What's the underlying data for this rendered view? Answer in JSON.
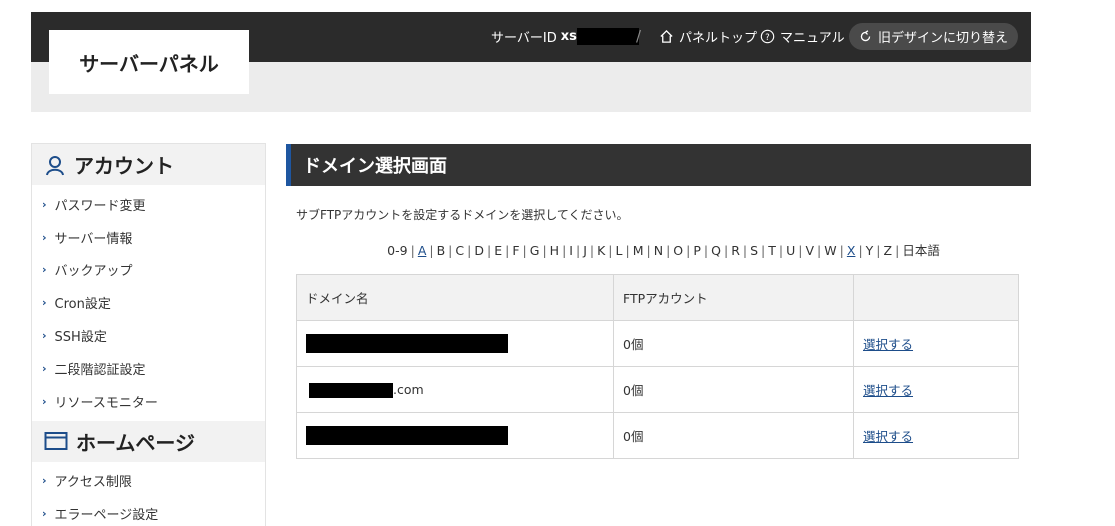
{
  "header": {
    "logo": "サーバーパネル",
    "server_id_label": "サーバーID",
    "server_id_prefix": "xs",
    "separator": "/",
    "panel_top": "パネルトップ",
    "manual": "マニュアル",
    "old_design": "旧デザインに切り替え"
  },
  "sidebar": {
    "sections": [
      {
        "title": "アカウント",
        "icon": "user-icon",
        "items": [
          "パスワード変更",
          "サーバー情報",
          "バックアップ",
          "Cron設定",
          "SSH設定",
          "二段階認証設定",
          "リソースモニター"
        ]
      },
      {
        "title": "ホームページ",
        "icon": "browser-window-icon",
        "items": [
          "アクセス制限",
          "エラーページ設定"
        ]
      }
    ]
  },
  "main": {
    "title": "ドメイン選択画面",
    "description": "サブFTPアカウントを設定するドメインを選択してください。",
    "alpha_index": [
      "0-9",
      "A",
      "B",
      "C",
      "D",
      "E",
      "F",
      "G",
      "H",
      "I",
      "J",
      "K",
      "L",
      "M",
      "N",
      "O",
      "P",
      "Q",
      "R",
      "S",
      "T",
      "U",
      "V",
      "W",
      "X",
      "Y",
      "Z",
      "日本語"
    ],
    "alpha_links": [
      "A",
      "X"
    ],
    "table": {
      "headers": [
        "ドメイン名",
        "FTPアカウント",
        ""
      ],
      "rows": [
        {
          "domain_suffix": "",
          "ftp_count": "0個",
          "action": "選択する"
        },
        {
          "domain_suffix": ".com",
          "ftp_count": "0個",
          "action": "選択する"
        },
        {
          "domain_suffix": "",
          "ftp_count": "0個",
          "action": "選択する"
        }
      ]
    }
  },
  "colors": {
    "header_dark": "#2b2b2b",
    "header_gray": "#ececec",
    "title_bar": "#333333",
    "accent_blue": "#1e56a0",
    "link": "#1d4d8a"
  }
}
